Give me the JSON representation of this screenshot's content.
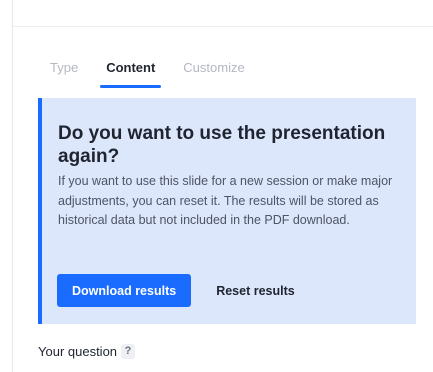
{
  "tabs": [
    {
      "label": "Type",
      "active": false
    },
    {
      "label": "Content",
      "active": true
    },
    {
      "label": "Customize",
      "active": false
    }
  ],
  "callout": {
    "title": "Do you want to use the presentation again?",
    "body": "If you want to use this slide for a new session or make major adjustments, you can reset it. The results will be stored as historical data but not included in the PDF download.",
    "primary_button": "Download results",
    "secondary_button": "Reset results"
  },
  "question": {
    "label": "Your question",
    "help_icon": "?"
  },
  "colors": {
    "accent": "#196cff",
    "callout_background": "#dce7fb",
    "text": "#1f2430",
    "inactive_tab": "#b4b8c2"
  }
}
